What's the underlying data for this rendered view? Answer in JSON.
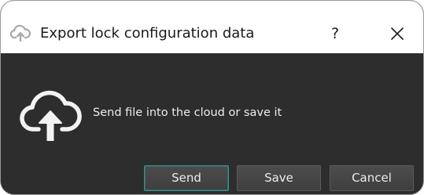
{
  "window": {
    "title": "Export lock configuration data",
    "help_label": "?",
    "title_icon": "cloud-upload-icon",
    "close_icon": "close-icon"
  },
  "content": {
    "icon": "cloud-upload-icon",
    "message": "Send file into the cloud or save it"
  },
  "buttons": {
    "send": "Send",
    "save": "Save",
    "cancel": "Cancel"
  },
  "colors": {
    "titlebar_background": "#ffffff",
    "content_background": "#2d2d2d",
    "text_light": "#ececec",
    "default_button_border": "#3d8d8a"
  }
}
